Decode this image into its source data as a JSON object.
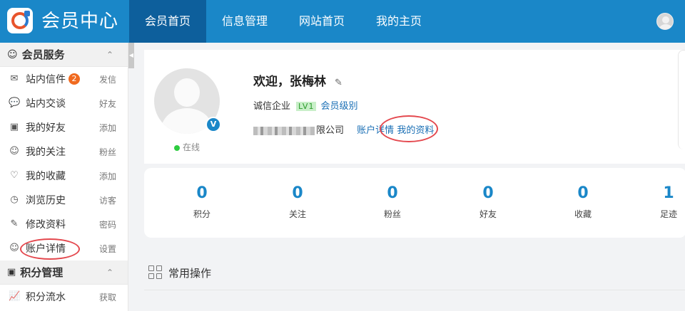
{
  "header": {
    "brand": "会员中心",
    "nav": [
      {
        "label": "会员首页",
        "active": true
      },
      {
        "label": "信息管理",
        "active": false
      },
      {
        "label": "网站首页",
        "active": false
      },
      {
        "label": "我的主页",
        "active": false
      }
    ]
  },
  "sidebar": {
    "group1": {
      "title": "会员服务",
      "icon": "member-icon"
    },
    "items": [
      {
        "icon": "mail-icon",
        "label": "站内信件",
        "badge": "2",
        "extra": "发信"
      },
      {
        "icon": "chat-icon",
        "label": "站内交谈",
        "extra": "好友"
      },
      {
        "icon": "contact-icon",
        "label": "我的好友",
        "extra": "添加"
      },
      {
        "icon": "user-icon",
        "label": "我的关注",
        "extra": "粉丝"
      },
      {
        "icon": "heart-icon",
        "label": "我的收藏",
        "extra": "添加"
      },
      {
        "icon": "clock-icon",
        "label": "浏览历史",
        "extra": "访客"
      },
      {
        "icon": "edit-icon",
        "label": "修改资料",
        "extra": "密码"
      },
      {
        "icon": "user-icon",
        "label": "账户详情",
        "extra": "设置"
      }
    ],
    "group2": {
      "title": "积分管理",
      "icon": "points-icon"
    },
    "items2": [
      {
        "icon": "chart-icon",
        "label": "积分流水",
        "extra": "获取"
      }
    ]
  },
  "profile": {
    "welcome": "欢迎，张梅林",
    "company_type": "诚信企业",
    "level_badge": "LV1",
    "level_link": "会员级别",
    "company_suffix": "限公司",
    "account_link": "账户详情",
    "profile_link": "我的资料",
    "online_text": "在线",
    "verified": "V"
  },
  "stats": [
    {
      "value": "0",
      "label": "积分"
    },
    {
      "value": "0",
      "label": "关注"
    },
    {
      "value": "0",
      "label": "粉丝"
    },
    {
      "value": "0",
      "label": "好友"
    },
    {
      "value": "0",
      "label": "收藏"
    },
    {
      "value": "1",
      "label": "足迹"
    }
  ],
  "ops": {
    "title": "常用操作"
  },
  "colors": {
    "header": "#1a87c8",
    "nav_active": "#0d5f9c",
    "badge": "#f06a1f",
    "highlight": "#e4484e",
    "stat_number": "#1a87c8"
  }
}
